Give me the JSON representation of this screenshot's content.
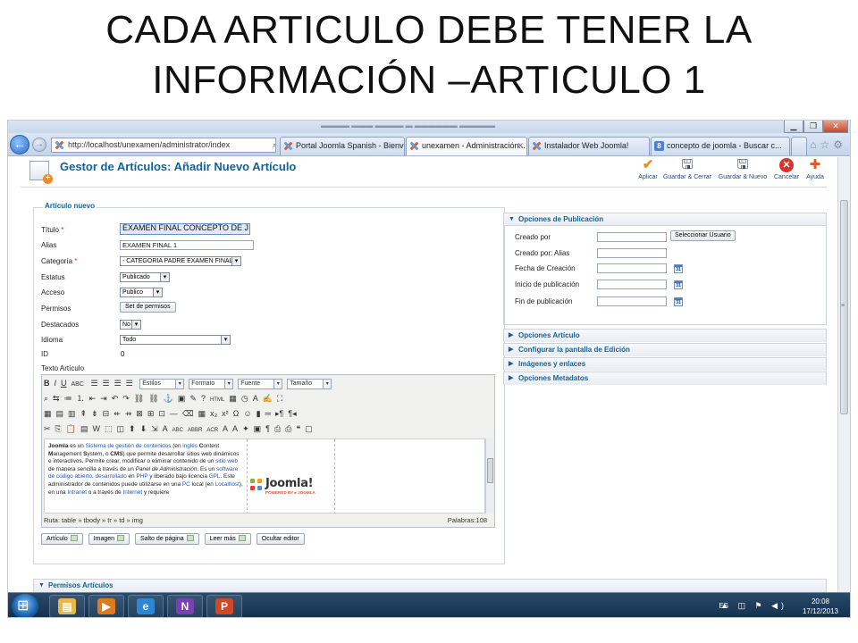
{
  "slide": {
    "title_line1": "CADA ARTICULO DEBE TENER LA",
    "title_line2": "INFORMACIÓN –ARTICULO 1"
  },
  "browser": {
    "address": "http://localhost/unexamen/administrator/index",
    "address_tools": "⌕ ▾ ☒ ◇ ✕",
    "tabs": [
      {
        "label": "Portal Joomla Spanish - Bienve...",
        "icon": "joomla-icon"
      },
      {
        "label": "unexamen - Administración...",
        "icon": "joomla-icon",
        "active": true
      },
      {
        "label": "Instalador Web Joomla!",
        "icon": "joomla-icon"
      },
      {
        "label": "concepto de joomla - Buscar c...",
        "icon": "google-icon"
      }
    ],
    "right_icons": "⌂☆⚙",
    "window_buttons": [
      "▁",
      "❐",
      "✕"
    ]
  },
  "header": {
    "title": "Gestor de Artículos: Añadir Nuevo Artículo",
    "toolbar": [
      {
        "label": "Aplicar",
        "icon": "check-icon"
      },
      {
        "label": "Guardar & Cerrar",
        "icon": "save-close-icon"
      },
      {
        "label": "Guardar & Nuevo",
        "icon": "save-new-icon"
      },
      {
        "label": "Cancelar",
        "icon": "cancel-icon"
      },
      {
        "label": "Ayuda",
        "icon": "help-icon"
      }
    ]
  },
  "form": {
    "legend": "Artículo nuevo",
    "titulo_label": "Título",
    "titulo_value": "EXAMEN FINAL CONCEPTO DE J",
    "alias_label": "Alias",
    "alias_value": "EXAMEN FINAL 1",
    "categoria_label": "Categoría",
    "categoria_value": "- CATEGORIA PADRE EXAMEN FINAL",
    "estatus_label": "Estatus",
    "estatus_value": "Publicado",
    "acceso_label": "Acceso",
    "acceso_value": "Publico",
    "permisos_label": "Permisos",
    "permisos_button": "Set de permisos",
    "destacados_label": "Destacados",
    "destacados_value": "No",
    "idioma_label": "Idioma",
    "idioma_value": "Todo",
    "id_label": "ID",
    "id_value": "0",
    "texto_label": "Texto Artículo",
    "required_mark": "*"
  },
  "editor": {
    "selects": [
      "Estilos",
      "Formato",
      "Fuente",
      "Tamaño"
    ],
    "path": "Ruta: table » tbody » tr » td » img",
    "words": "Palabras:108",
    "body_segments": [
      {
        "t": "Joomla",
        "b": true
      },
      {
        "t": " es un "
      },
      {
        "t": "Sistema de gestión de contenidos",
        "lnk": true
      },
      {
        "t": " (en "
      },
      {
        "t": "inglés",
        "lnk": true
      },
      {
        "t": " "
      },
      {
        "t": "C",
        "b": true
      },
      {
        "t": "ontent "
      },
      {
        "t": "M",
        "b": true
      },
      {
        "t": "anagement "
      },
      {
        "t": "S",
        "b": true
      },
      {
        "t": "ystem, o "
      },
      {
        "t": "CMS",
        "b": true
      },
      {
        "t": ") que permite desarrollar sitios web dinámicos e interactivos. Permite crear, modificar o eliminar contenido de un "
      },
      {
        "t": "sitio web",
        "lnk": true
      },
      {
        "t": " de manera sencilla a través de un "
      },
      {
        "t": "Panel de Administración",
        "i": true
      },
      {
        "t": ". Es un "
      },
      {
        "t": "software de código abierto",
        "lnk": true
      },
      {
        "t": ", "
      },
      {
        "t": "desarrollado",
        "lnk": true
      },
      {
        "t": " en "
      },
      {
        "t": "PHP",
        "lnk": true
      },
      {
        "t": " y liberado bajo licencia "
      },
      {
        "t": "GPL",
        "lnk": true
      },
      {
        "t": ". Este administrador de contenidos puede utilizarse en una "
      },
      {
        "t": "PC",
        "lnk": true
      },
      {
        "t": " local (en "
      },
      {
        "t": "Localhost",
        "lnk": true
      },
      {
        "t": "), en una "
      },
      {
        "t": "Intranet",
        "lnk": true
      },
      {
        "t": " o a través de "
      },
      {
        "t": "Internet",
        "lnk": true
      },
      {
        "t": " y requiere"
      }
    ],
    "logo_text": "Joomla!",
    "logo_tagline": "POWERED BY ▸ JOOMLA",
    "bottom_buttons": [
      "Artículo",
      "Imagen",
      "Salto de página",
      "Leer más",
      "Ocultar editor"
    ]
  },
  "publishing": {
    "header": "Opciones de Publicación",
    "creado_por": "Creado por",
    "select_user": "Seleccionar Usuario",
    "creado_por_alias": "Creado por: Alias",
    "fecha_creacion": "Fecha de Creación",
    "inicio_publicacion": "Inicio de publicación",
    "fin_publicacion": "Fin de publicación",
    "calendar_label": "31"
  },
  "side_panes": [
    "Opciones Artículo",
    "Configurar la pantalla de Edición",
    "Imágenes y enlaces",
    "Opciones Metadatos"
  ],
  "permisos_pane": "Permisos Artículos",
  "taskbar": {
    "apps": [
      {
        "name": "explorer",
        "color": "#e7b84a",
        "glyph": "▤"
      },
      {
        "name": "media-player",
        "color": "#e07a1c",
        "glyph": "▶"
      },
      {
        "name": "internet-explorer",
        "color": "#2f86d6",
        "glyph": "e"
      },
      {
        "name": "onenote",
        "color": "#7a3fb0",
        "glyph": "N"
      },
      {
        "name": "powerpoint",
        "color": "#d24726",
        "glyph": "P"
      }
    ],
    "lang": "ES",
    "tray_icons": "▲ ◫ ⚑ ◀)",
    "time": "20:08",
    "date": "17/12/2013"
  }
}
